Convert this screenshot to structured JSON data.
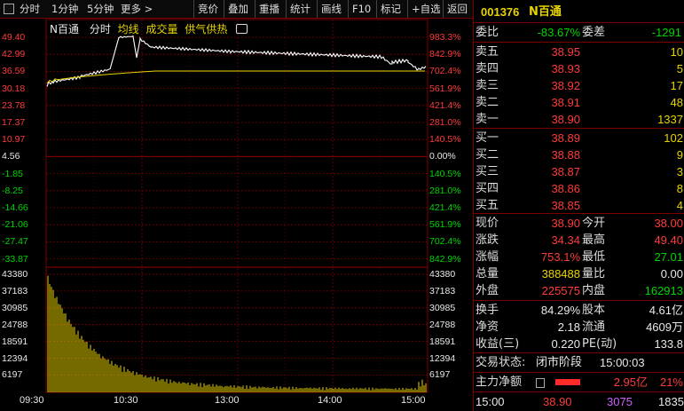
{
  "toolbar": {
    "items": [
      "分时",
      "1分钟",
      "5分钟",
      "更多 >",
      "竞价",
      "叠加",
      "重播",
      "统计",
      "画线",
      "F10",
      "标记",
      "+自选",
      "返回"
    ],
    "checkbox_icon": "checkbox-icon"
  },
  "chart": {
    "stock_name": "N百通",
    "tabs": [
      "分时",
      "均线",
      "成交量",
      "供气供热"
    ],
    "camera_icon": "camera-icon",
    "price_labels_left": [
      "49.40",
      "42.99",
      "36.59",
      "30.18",
      "23.78",
      "17.37",
      "10.97",
      "4.56",
      "-1.85",
      "-8.25",
      "-14.66",
      "-21.06",
      "-27.47",
      "-33.87"
    ],
    "pct_labels_right": [
      "983.3%",
      "842.9%",
      "702.4%",
      "561.9%",
      "421.4%",
      "281.0%",
      "140.5%",
      "0.00%",
      "140.5%",
      "281.0%",
      "421.4%",
      "561.9%",
      "702.4%",
      "842.9%"
    ],
    "volume_labels_left": [
      "43380",
      "37183",
      "30985",
      "24788",
      "18591",
      "12394",
      "6197"
    ],
    "volume_labels_right": [
      "43380",
      "37183",
      "30985",
      "24788",
      "18591",
      "12394",
      "6197"
    ],
    "time_labels": [
      "09:30",
      "10:30",
      "13:00",
      "14:00",
      "15:00"
    ],
    "colors": {
      "up": "#ff3b3b",
      "down": "#00d600",
      "price_line": "#ffffff",
      "avg_line": "#e8d400",
      "grid": "#7a0000"
    }
  },
  "panel": {
    "code": "001376",
    "name": "N百通",
    "weibi_label": "委比",
    "weibi": "-83.67%",
    "weicha_label": "委差",
    "weicha": "-1291",
    "asks": [
      {
        "label": "卖五",
        "price": "38.95",
        "vol": "10"
      },
      {
        "label": "卖四",
        "price": "38.93",
        "vol": "5"
      },
      {
        "label": "卖三",
        "price": "38.92",
        "vol": "17"
      },
      {
        "label": "卖二",
        "price": "38.91",
        "vol": "48"
      },
      {
        "label": "卖一",
        "price": "38.90",
        "vol": "1337"
      }
    ],
    "bids": [
      {
        "label": "买一",
        "price": "38.89",
        "vol": "102"
      },
      {
        "label": "买二",
        "price": "38.88",
        "vol": "9"
      },
      {
        "label": "买三",
        "price": "38.87",
        "vol": "3"
      },
      {
        "label": "买四",
        "price": "38.86",
        "vol": "8"
      },
      {
        "label": "买五",
        "price": "38.85",
        "vol": "4"
      }
    ],
    "stats": [
      {
        "l1": "现价",
        "v1": "38.90",
        "l2": "今开",
        "v2": "38.00"
      },
      {
        "l1": "涨跌",
        "v1": "34.34",
        "l2": "最高",
        "v2": "49.40"
      },
      {
        "l1": "涨幅",
        "v1": "753.1%",
        "l2": "最低",
        "v2": "27.01"
      },
      {
        "l1": "总量",
        "v1": "388488",
        "l2": "量比",
        "v2": "0.00"
      },
      {
        "l1": "外盘",
        "v1": "225575",
        "l2": "内盘",
        "v2": "162913"
      }
    ],
    "stats2": [
      {
        "l1": "换手",
        "v1": "84.29%",
        "l2": "股本",
        "v2": "4.61亿"
      },
      {
        "l1": "净资",
        "v1": "2.18",
        "l2": "流通",
        "v2": "4609万"
      },
      {
        "l1": "收益(三)",
        "v1": "0.220",
        "l2": "PE(动)",
        "v2": "133.8"
      }
    ],
    "trade_status_label": "交易状态:",
    "trade_status": "闭市阶段",
    "trade_time": "15:00:03",
    "main_flow_label": "主力净额",
    "main_flow_value": "2.95亿",
    "main_flow_pct": "21%",
    "last_tick": {
      "time": "15:00",
      "price": "38.90",
      "vol": "3075",
      "num": "1835"
    }
  }
}
